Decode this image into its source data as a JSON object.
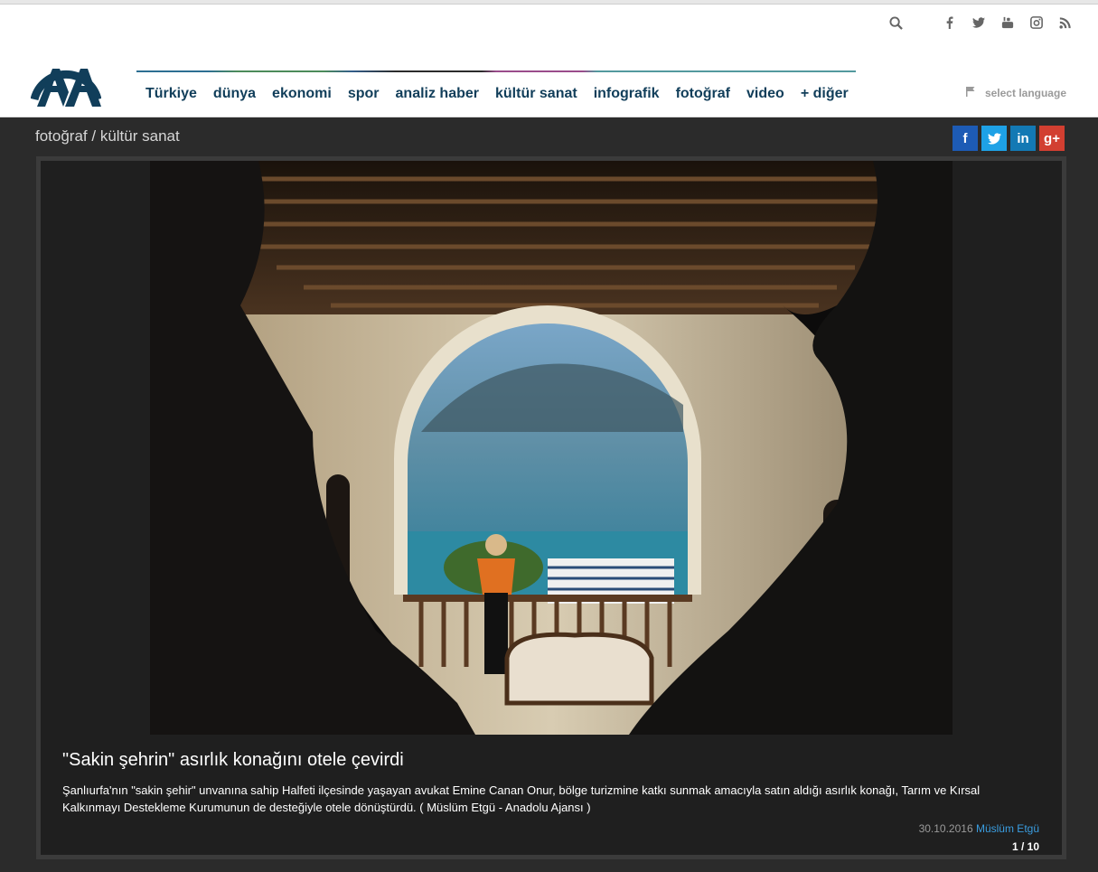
{
  "header": {
    "social": [
      "search-icon",
      "facebook-icon",
      "twitter-icon",
      "youtube-icon",
      "instagram-icon",
      "rss-icon"
    ],
    "nav": [
      {
        "label": "Türkiye"
      },
      {
        "label": "dünya"
      },
      {
        "label": "ekonomi"
      },
      {
        "label": "spor"
      },
      {
        "label": "analiz haber"
      },
      {
        "label": "kültür sanat"
      },
      {
        "label": "infografik"
      },
      {
        "label": "fotoğraf"
      },
      {
        "label": "video"
      },
      {
        "label": "+ diğer"
      }
    ],
    "language_label": "select language",
    "colors": {
      "nav_text": "#113e5a",
      "logo": "#113e5a"
    }
  },
  "breadcrumb": "fotoğraf / kültür sanat",
  "share": {
    "facebook": "f",
    "twitter": "twitter-icon",
    "linkedin": "in",
    "googleplus": "g+"
  },
  "gallery": {
    "title": "\"Sakin şehrin\" asırlık konağını otele çevirdi",
    "description": "Şanlıurfa'nın \"sakin şehir\" unvanına sahip Halfeti ilçesinde yaşayan avukat Emine Canan Onur, bölge turizmine katkı sunmak amacıyla satın aldığı asırlık konağı, Tarım ve Kırsal Kalkınmayı Destekleme Kurumunun de desteğiyle otele dönüştürdü. ( Müslüm Etgü - Anadolu Ajansı )",
    "date": "30.10.2016",
    "author": "Müslüm Etgü",
    "counter": "1 / 10"
  }
}
